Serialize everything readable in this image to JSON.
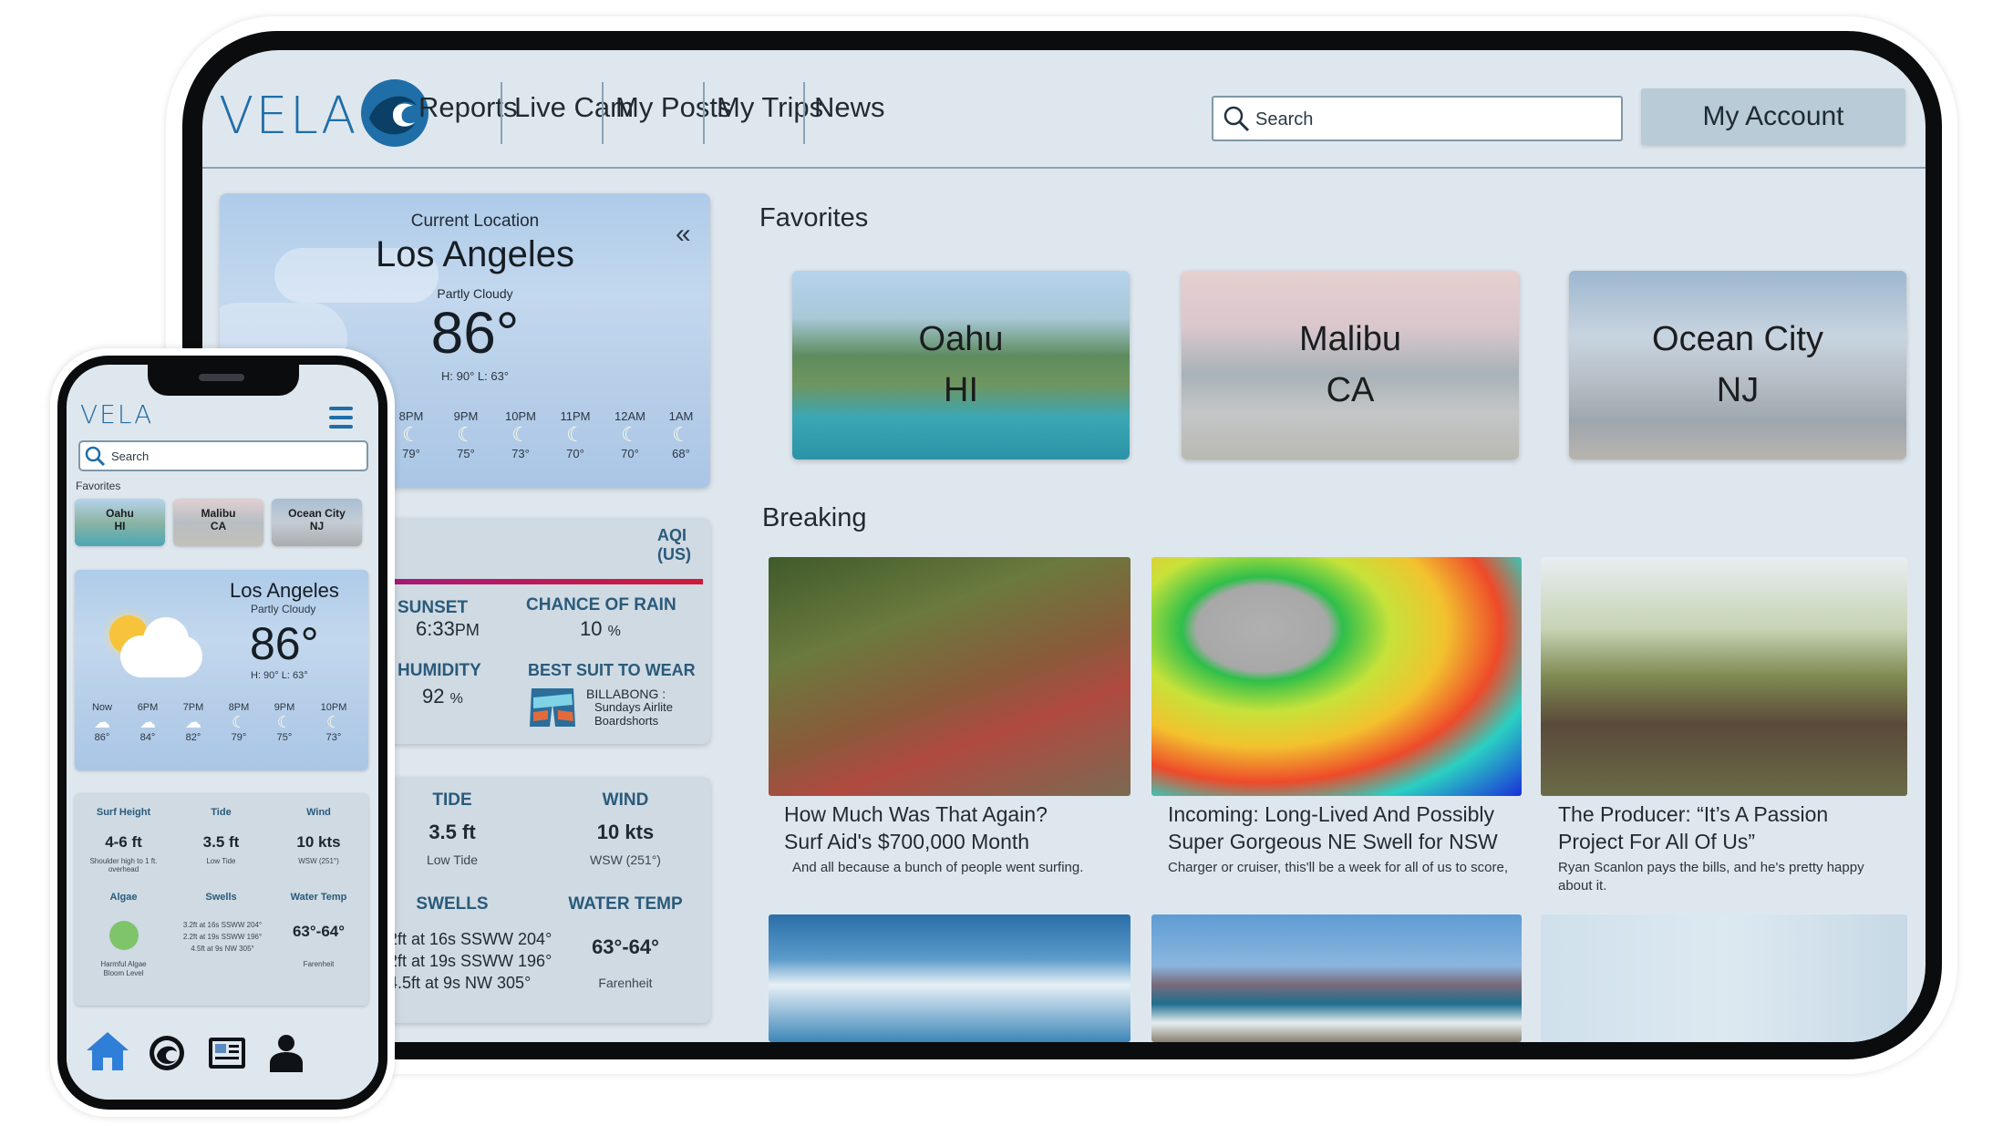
{
  "brand": {
    "name": "VELA",
    "accent": "#1f6ea8"
  },
  "nav": {
    "links": [
      "Reports",
      "Live Cam",
      "My Posts",
      "My Trips",
      "News"
    ],
    "search_placeholder": "Search",
    "account_label": "My Account"
  },
  "weather": {
    "current_label": "Current Location",
    "city": "Los Angeles",
    "condition": "Partly Cloudy",
    "temp": "86°",
    "hilo": "H: 90°  L: 63°",
    "collapse_icon": "«",
    "hourly": [
      {
        "time": "8PM",
        "temp": "79°"
      },
      {
        "time": "9PM",
        "temp": "75°"
      },
      {
        "time": "10PM",
        "temp": "73°"
      },
      {
        "time": "11PM",
        "temp": "70°"
      },
      {
        "time": "12AM",
        "temp": "70°"
      },
      {
        "time": "1AM",
        "temp": "68°"
      }
    ]
  },
  "conditions": {
    "aqi_label": "AQI (US)",
    "sunset_label": "SUNSET",
    "sunset_value": "6:33",
    "sunset_unit": "PM",
    "rain_label": "CHANCE OF RAIN",
    "rain_value": "10",
    "rain_unit": "%",
    "humidity_label": "HUMIDITY",
    "humidity_value": "92",
    "humidity_unit": "%",
    "suit_label": "BEST SUIT TO WEAR",
    "suit_brand": "BILLABONG :",
    "suit_line2": "Sundays Airlite",
    "suit_line3": "Boardshorts"
  },
  "surf": {
    "tide_label": "TIDE",
    "tide_value": "3.5 ft",
    "tide_sub": "Low Tide",
    "wind_label": "WIND",
    "wind_value": "10 kts",
    "wind_sub": "WSW (251°)",
    "swells_label": "SWELLS",
    "swells": [
      "2ft at 16s SSWW 204°",
      "2ft at 19s SSWW 196°",
      "4.5ft at 9s NW 305°"
    ],
    "water_label": "WATER TEMP",
    "water_value": "63°-64°",
    "water_sub": "Farenheit"
  },
  "favorites": {
    "heading": "Favorites",
    "items": [
      {
        "line1": "Oahu",
        "line2": "HI"
      },
      {
        "line1": "Malibu",
        "line2": "CA"
      },
      {
        "line1": "Ocean City",
        "line2": "NJ"
      }
    ]
  },
  "breaking": {
    "heading": "Breaking",
    "items": [
      {
        "title1": "How Much Was That Again?",
        "title2": "Surf Aid's $700,000 Month",
        "sub1": "And all because a bunch of people went surfing.",
        "sub2": ""
      },
      {
        "title1": "Incoming: Long-Lived And Possibly",
        "title2": "Super Gorgeous NE Swell for NSW",
        "sub1": "Charger or cruiser, this'll be a week for all of us to score,",
        "sub2": ""
      },
      {
        "title1": "The Producer: “It’s A Passion",
        "title2": "Project For All Of Us”",
        "sub1": "Ryan Scanlon pays the bills, and he's pretty happy",
        "sub2": "about it."
      }
    ]
  },
  "phone": {
    "brand": "VELA",
    "search_placeholder": "Search",
    "favorites_label": "Favorites",
    "favorites": [
      {
        "line1": "Oahu",
        "line2": "HI"
      },
      {
        "line1": "Malibu",
        "line2": "CA"
      },
      {
        "line1": "Ocean City",
        "line2": "NJ"
      }
    ],
    "city": "Los Angeles",
    "condition": "Partly Cloudy",
    "temp": "86°",
    "hilo": "H: 90°  L: 63°",
    "hourly": [
      {
        "time": "Now",
        "temp": "86°"
      },
      {
        "time": "6PM",
        "temp": "84°"
      },
      {
        "time": "7PM",
        "temp": "82°"
      },
      {
        "time": "8PM",
        "temp": "79°"
      },
      {
        "time": "9PM",
        "temp": "75°"
      },
      {
        "time": "10PM",
        "temp": "73°"
      }
    ],
    "surf_height_label": "Surf Height",
    "surf_height_value": "4-6 ft",
    "surf_height_sub": "Shoulder high to 1 ft. overhead",
    "tide_label": "Tide",
    "tide_value": "3.5 ft",
    "tide_sub": "Low Tide",
    "wind_label": "Wind",
    "wind_value": "10 kts",
    "wind_sub": "WSW (251°)",
    "algae_label": "Algae",
    "algae_sub1": "Harmful Algae",
    "algae_sub2": "Bloom Level",
    "swells_label": "Swells",
    "swells": [
      "3.2ft at 16s SSWW 204°",
      "2.2ft at 19s SSWW 196°",
      "4.5ft at 9s NW 305°"
    ],
    "water_label": "Water Temp",
    "water_value": "63°-64°",
    "water_sub": "Farenheit",
    "tabs": [
      "home-icon",
      "vela-icon",
      "news-icon",
      "account-icon"
    ]
  }
}
